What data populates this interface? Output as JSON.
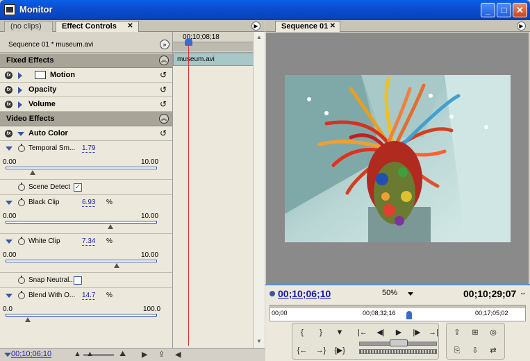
{
  "window": {
    "title": "Monitor",
    "minimize": "_",
    "maximize": "□",
    "close": "✕"
  },
  "left_tabs": {
    "inactive": "(no clips)",
    "active": "Effect Controls",
    "close": "✕"
  },
  "effect_controls": {
    "sequence_clip": "Sequence 01 * museum.avi",
    "fixed_effects_label": "Fixed Effects",
    "fixed": [
      {
        "name": "Motion"
      },
      {
        "name": "Opacity"
      },
      {
        "name": "Volume"
      }
    ],
    "video_effects_label": "Video Effects",
    "auto_color": {
      "name": "Auto Color",
      "temporal": {
        "name": "Temporal Sm...",
        "value": "1.79",
        "min": "0.00",
        "max": "10.00",
        "level": 0.179
      },
      "scene_detect": {
        "name": "Scene Detect",
        "checked": true
      },
      "black_clip": {
        "name": "Black Clip",
        "value": "6.93",
        "unit": "%",
        "min": "0.00",
        "max": "10.00",
        "level": 0.693
      },
      "white_clip": {
        "name": "White Clip",
        "value": "7.34",
        "unit": "%",
        "min": "0.00",
        "max": "10.00",
        "level": 0.734
      },
      "snap_neutral": {
        "name": "Snap Neutral...",
        "checked": false
      },
      "blend": {
        "name": "Blend With O...",
        "value": "14.7",
        "unit": "%",
        "min": "0.0",
        "max": "100.0",
        "level": 0.147
      }
    },
    "timeline_tc": "00;10;08;18",
    "timeline_clip": "museum.avi",
    "current_tc": "00;10;06;10"
  },
  "right_tabs": {
    "active": "Sequence 01",
    "close": "✕"
  },
  "monitor": {
    "current_tc": "00;10;06;10",
    "zoom": "50%",
    "duration_tc": "00;10;29;07",
    "ruler_ticks": [
      "00;00",
      "00;08;32;16",
      "00;17;05;02"
    ]
  },
  "colors": {
    "accent": "#1a1ab0",
    "playhead": "#e03030",
    "section_bg": "#a8a598",
    "title_bar": "#0b4ed0"
  }
}
